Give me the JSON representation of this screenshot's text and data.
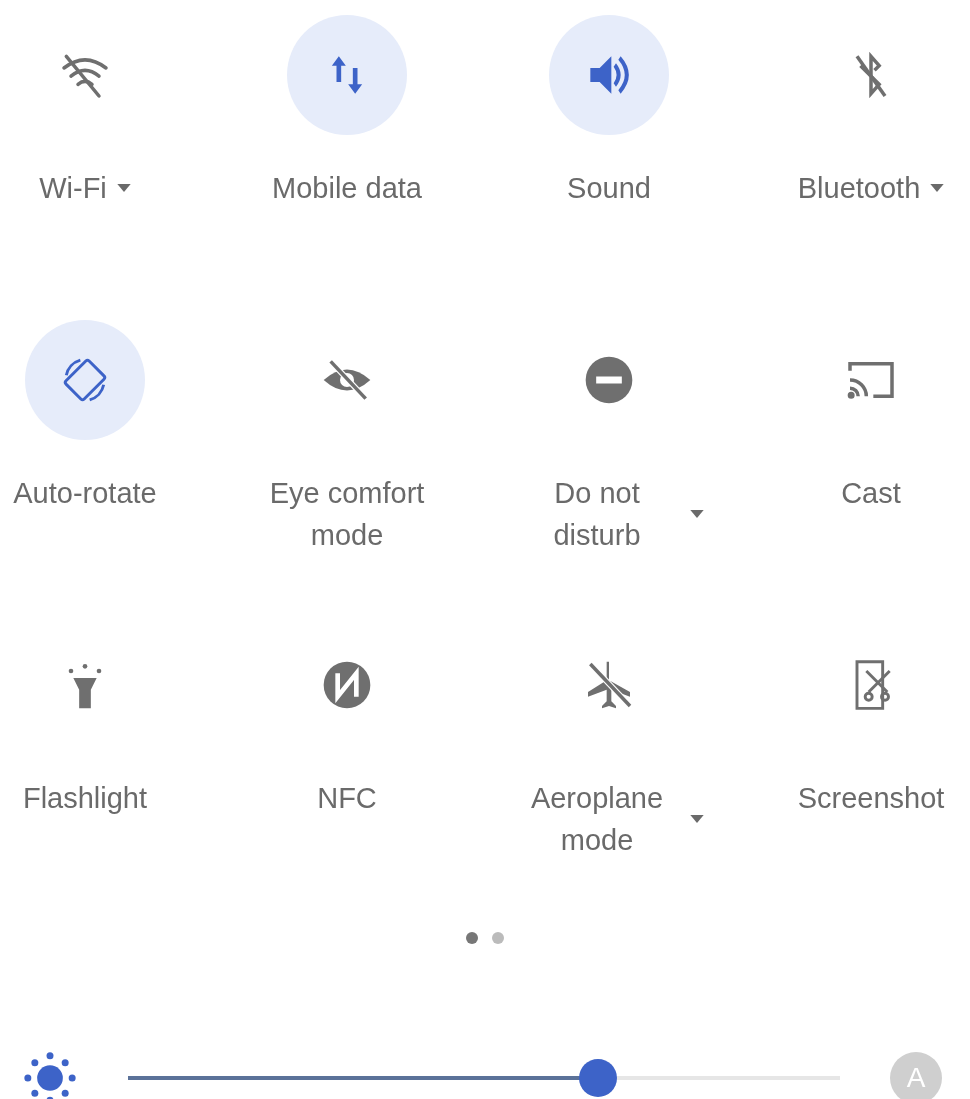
{
  "tiles": [
    {
      "kind": "wifi",
      "label": "Wi-Fi",
      "on": false,
      "dropdown": true
    },
    {
      "kind": "data",
      "label": "Mobile data",
      "on": true,
      "dropdown": false
    },
    {
      "kind": "sound",
      "label": "Sound",
      "on": true,
      "dropdown": false
    },
    {
      "kind": "bluetooth",
      "label": "Bluetooth",
      "on": false,
      "dropdown": true
    },
    {
      "kind": "rotate",
      "label": "Auto-rotate",
      "on": true,
      "dropdown": false
    },
    {
      "kind": "eye",
      "label": "Eye comfort mode",
      "on": false,
      "dropdown": false
    },
    {
      "kind": "dnd",
      "label": "Do not disturb",
      "on": false,
      "dropdown": true
    },
    {
      "kind": "cast",
      "label": "Cast",
      "on": false,
      "dropdown": false
    },
    {
      "kind": "flashlight",
      "label": "Flashlight",
      "on": false,
      "dropdown": false
    },
    {
      "kind": "nfc",
      "label": "NFC",
      "on": false,
      "dropdown": false
    },
    {
      "kind": "airplane",
      "label": "Aeroplane mode",
      "on": false,
      "dropdown": true
    },
    {
      "kind": "screenshot",
      "label": "Screenshot",
      "on": false,
      "dropdown": false
    }
  ],
  "pages": [
    {
      "selected": true
    },
    {
      "selected": false
    }
  ],
  "brightness": {
    "level": 0.66,
    "auto_label": "A"
  }
}
